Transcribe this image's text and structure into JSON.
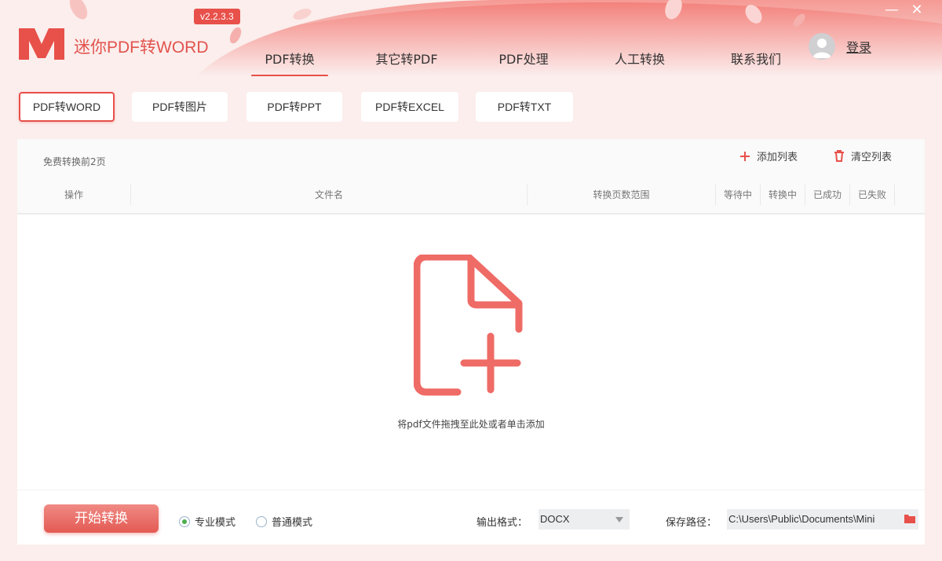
{
  "app": {
    "title": "迷你PDF转WORD",
    "version": "v2.2.3.3"
  },
  "nav": {
    "items": [
      {
        "label": "PDF转换",
        "active": true
      },
      {
        "label": "其它转PDF",
        "active": false
      },
      {
        "label": "PDF处理",
        "active": false
      },
      {
        "label": "人工转换",
        "active": false
      },
      {
        "label": "联系我们",
        "active": false
      }
    ]
  },
  "user": {
    "login_label": "登录"
  },
  "window": {
    "minimize": "—",
    "close": "✕"
  },
  "subtabs": [
    {
      "label": "PDF转WORD",
      "active": true
    },
    {
      "label": "PDF转图片",
      "active": false
    },
    {
      "label": "PDF转PPT",
      "active": false
    },
    {
      "label": "PDF转EXCEL",
      "active": false
    },
    {
      "label": "PDF转TXT",
      "active": false
    }
  ],
  "toolbar": {
    "free_note": "免费转换前2页",
    "add_list": "添加列表",
    "clear_list": "清空列表"
  },
  "table": {
    "columns": [
      "操作",
      "文件名",
      "转换页数范围",
      "等待中",
      "转换中",
      "已成功",
      "已失败"
    ]
  },
  "dropzone": {
    "hint": "将pdf文件拖拽至此处或者单击添加"
  },
  "footer": {
    "start_label": "开始转换",
    "mode_pro": "专业模式",
    "mode_normal": "普通模式",
    "selected_mode": "专业模式",
    "format_label": "输出格式：",
    "format_value": "DOCX",
    "save_label": "保存路径：",
    "save_path": "C:\\Users\\Public\\Documents\\Mini"
  },
  "colors": {
    "accent": "#e8504a",
    "background": "#fbeeed",
    "icon": "#ef6b66"
  }
}
